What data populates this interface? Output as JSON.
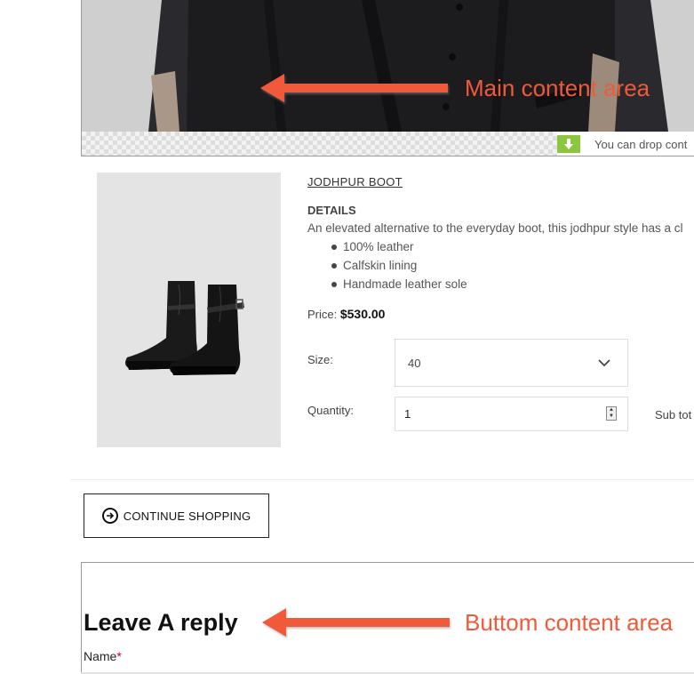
{
  "hero": {
    "drop_text": "You can drop cont",
    "annotation": "Main content area"
  },
  "product": {
    "title": "JODHPUR BOOT",
    "details_heading": "DETAILS",
    "description": "An elevated alternative to the everyday boot, this jodhpur style has a cl",
    "features": [
      "100% leather",
      "Calfskin lining",
      "Handmade leather sole"
    ],
    "price_label": "Price:",
    "price_value": "$530.00",
    "size_label": "Size:",
    "size_value": "40",
    "quantity_label": "Quantity:",
    "quantity_value": "1",
    "subtotal_label": "Sub tot"
  },
  "continue_button": {
    "label": "CONTINUE SHOPPING"
  },
  "reply": {
    "heading": "Leave A reply",
    "name_label": "Name",
    "required_mark": "*",
    "annotation": "Buttom content area"
  },
  "colors": {
    "annotation": "#f05a3a",
    "drop_arrow": "#8cc63f",
    "required": "#d0021b"
  }
}
